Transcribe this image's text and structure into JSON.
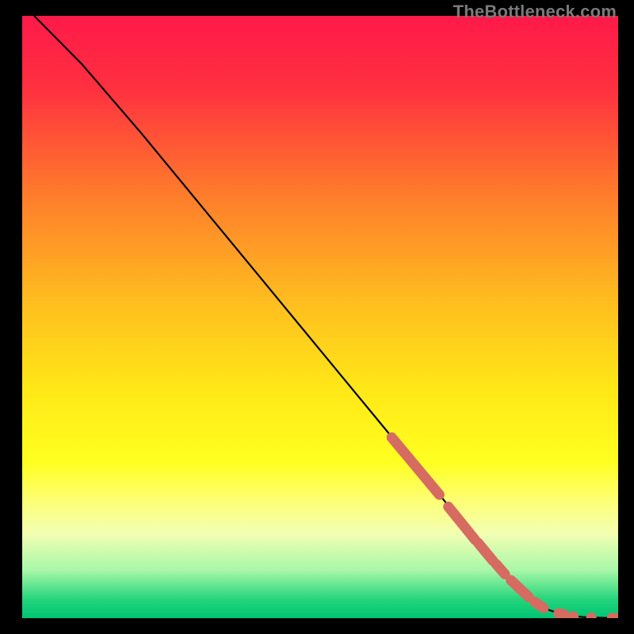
{
  "watermark": "TheBottleneck.com",
  "chart_data": {
    "type": "line",
    "title": "",
    "xlabel": "",
    "ylabel": "",
    "xlim": [
      0,
      100
    ],
    "ylim": [
      0,
      100
    ],
    "gradient_stops": [
      {
        "pos": 0,
        "color": "#ff1a49"
      },
      {
        "pos": 12,
        "color": "#ff3040"
      },
      {
        "pos": 30,
        "color": "#ff7d2b"
      },
      {
        "pos": 48,
        "color": "#ffbf1f"
      },
      {
        "pos": 62,
        "color": "#ffe817"
      },
      {
        "pos": 74,
        "color": "#ffff20"
      },
      {
        "pos": 80,
        "color": "#ffff6e"
      },
      {
        "pos": 86,
        "color": "#f2ffb3"
      },
      {
        "pos": 92,
        "color": "#a9f7a8"
      },
      {
        "pos": 97,
        "color": "#22d47b"
      },
      {
        "pos": 100,
        "color": "#00c472"
      }
    ],
    "series": [
      {
        "name": "bottleneck-curve",
        "color": "#000000",
        "x": [
          2,
          4,
          6,
          10,
          20,
          30,
          40,
          50,
          60,
          70,
          80,
          85,
          88,
          90,
          92,
          94,
          96,
          98,
          100
        ],
        "y": [
          100,
          98,
          96,
          92,
          80.5,
          68.5,
          56.5,
          44.5,
          32.5,
          20.5,
          8.5,
          3.5,
          1.5,
          0.8,
          0.4,
          0.2,
          0.1,
          0.05,
          0.05
        ]
      }
    ],
    "markers": {
      "name": "highlighted-range",
      "color": "#d66b61",
      "segments": [
        {
          "x0": 62,
          "y0": 30,
          "x1": 70,
          "y1": 20.5
        },
        {
          "x0": 71.5,
          "y0": 18.5,
          "x1": 76,
          "y1": 13
        },
        {
          "x0": 76.5,
          "y0": 12.5,
          "x1": 79,
          "y1": 9.5
        },
        {
          "x0": 79.5,
          "y0": 9.0,
          "x1": 81,
          "y1": 7.3
        },
        {
          "x0": 82,
          "y0": 6.3,
          "x1": 85,
          "y1": 3.5
        },
        {
          "x0": 86,
          "y0": 2.7,
          "x1": 87.5,
          "y1": 1.7
        },
        {
          "x0": 90,
          "y0": 0.8,
          "x1": 91,
          "y1": 0.6
        }
      ],
      "dots": [
        {
          "x": 92.5,
          "y": 0.3
        },
        {
          "x": 95.5,
          "y": 0.1
        },
        {
          "x": 99.0,
          "y": 0.05
        },
        {
          "x": 100.0,
          "y": 0.05
        }
      ]
    }
  }
}
